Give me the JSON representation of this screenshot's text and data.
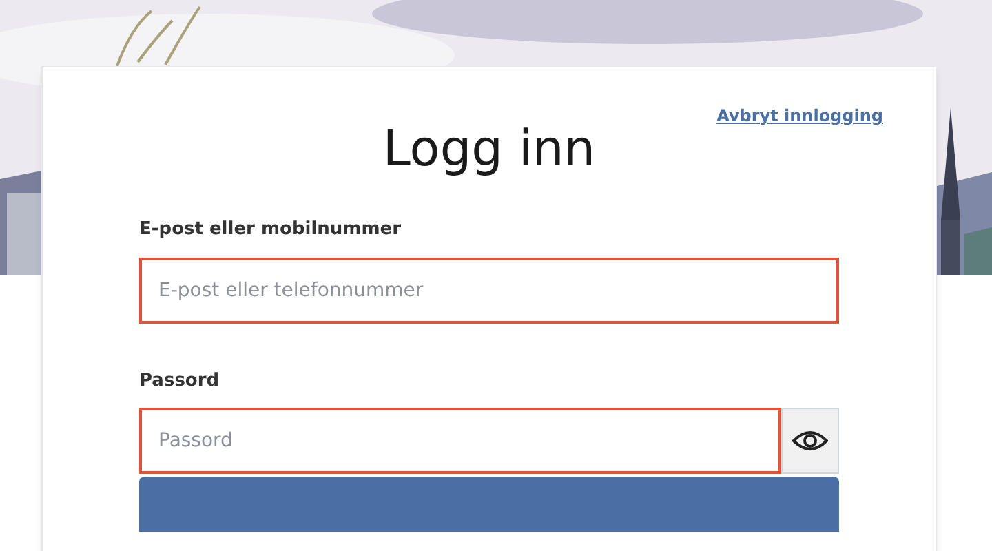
{
  "cancel_link": "Avbryt innlogging",
  "title": "Logg inn",
  "fields": [
    {
      "label": "E-post eller mobilnummer",
      "placeholder": "E-post eller telefonnummer",
      "error": true,
      "kind": "text"
    },
    {
      "label": "Passord",
      "placeholder": "Passord",
      "error": true,
      "kind": "password"
    }
  ]
}
